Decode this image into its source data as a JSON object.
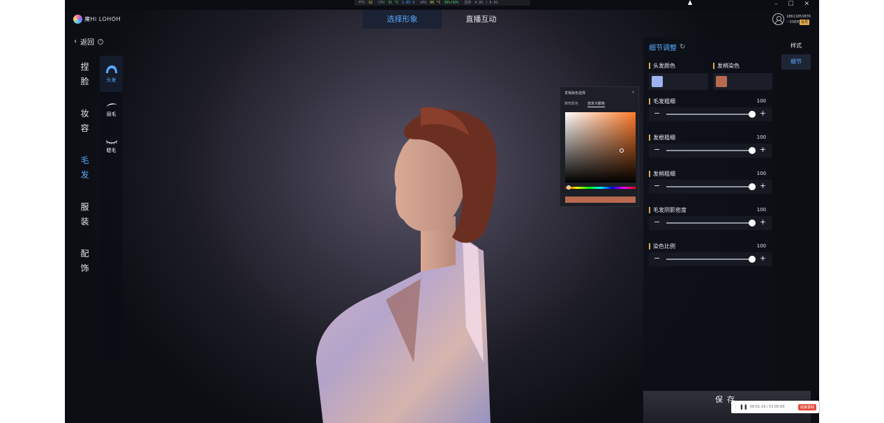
{
  "perf": {
    "fps_label": "FPS",
    "fps": "32",
    "cpu_label": "CPU",
    "cpu_temp": "31 °C",
    "cpu_volt": "1.05 V",
    "gpu_label": "GPU",
    "gpu_temp": "66 °C",
    "gpu_load": "30%/93%",
    "mem_label": "显存",
    "mem": "4.8G / 8.0G"
  },
  "window": {
    "controls": "– ☐ ✕"
  },
  "app": {
    "logo_text": "魔Hi LOHOH"
  },
  "top_tabs": [
    {
      "label": "选择形象"
    },
    {
      "label": "直播互动"
    }
  ],
  "user": {
    "phone": "18611853876",
    "days": "338天",
    "badge": "会员"
  },
  "back": {
    "label": "返回",
    "help": "?"
  },
  "categories": [
    {
      "label": "捏脸",
      "l1": "捏",
      "l2": "脸"
    },
    {
      "l1": "妆",
      "l2": "容"
    },
    {
      "l1": "毛",
      "l2": "发"
    },
    {
      "l1": "服",
      "l2": "装"
    },
    {
      "l1": "配",
      "l2": "饰"
    }
  ],
  "subcategories": [
    {
      "label": "头发",
      "icon": "hair-icon"
    },
    {
      "label": "眉毛",
      "icon": "eyebrow-icon"
    },
    {
      "label": "睫毛",
      "icon": "eyelash-icon"
    }
  ],
  "color_picker": {
    "title": "发梢染色选择",
    "close": "×",
    "tabs": [
      "推荐颜色",
      "自定义颜色"
    ],
    "selected_color": "#b7694f",
    "hue_color": "#ff7a2a"
  },
  "panel": {
    "title": "细节调整",
    "hair_color_label": "头发颜色",
    "hair_color": "#9fb3f0",
    "tip_color_label": "发梢染色",
    "tip_color": "#b7694f",
    "sliders": [
      {
        "label": "毛发粗细",
        "value": "100",
        "level": 1.0
      },
      {
        "label": "发根粗细",
        "value": "100",
        "level": 1.0
      },
      {
        "label": "发梢粗细",
        "value": "100",
        "level": 1.0
      },
      {
        "label": "毛发阴影密度",
        "value": "100",
        "level": 1.0
      },
      {
        "label": "染色比例",
        "value": "100",
        "level": 1.0
      }
    ],
    "minus": "−",
    "plus": "+"
  },
  "modes": [
    {
      "label": "样式"
    },
    {
      "label": "细节"
    }
  ],
  "save": {
    "label": "保存"
  },
  "recording": {
    "time": "00:01:19 / 01:00:00",
    "stop_label": "结束录制"
  },
  "colors": {
    "accent": "#58a9ff",
    "marker": "#e0a94a"
  }
}
